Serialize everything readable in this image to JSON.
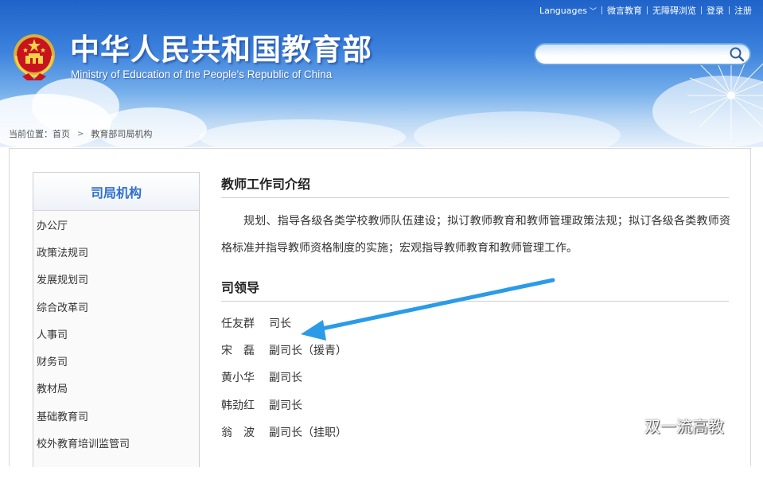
{
  "header": {
    "title": "中华人民共和国教育部",
    "subtitle": "Ministry of Education of the People's Republic of China",
    "topbar": {
      "languages": "Languages",
      "weiyan": "微言教育",
      "accessible": "无障碍浏览",
      "login": "登录",
      "register": "注册"
    },
    "search": {
      "placeholder": ""
    }
  },
  "breadcrumb": {
    "prefix": "当前位置：",
    "home": "首页",
    "current": "教育部司局机构"
  },
  "sidebar": {
    "title": "司局机构",
    "items": [
      {
        "label": "办公厅"
      },
      {
        "label": "政策法规司"
      },
      {
        "label": "发展规划司"
      },
      {
        "label": "综合改革司"
      },
      {
        "label": "人事司"
      },
      {
        "label": "财务司"
      },
      {
        "label": "教材局"
      },
      {
        "label": "基础教育司"
      },
      {
        "label": "校外教育培训监管司"
      }
    ]
  },
  "content": {
    "intro_title": "教师工作司介绍",
    "intro_text": "规划、指导各级各类学校教师队伍建设；拟订教师教育和教师管理政策法规；拟订各级各类教师资格标准并指导教师资格制度的实施；宏观指导教师教育和教师管理工作。",
    "leaders_title": "司领导",
    "leaders": [
      {
        "name": "任友群",
        "title": "司长"
      },
      {
        "name": "宋　磊",
        "title": "副司长（援青）"
      },
      {
        "name": "黄小华",
        "title": "副司长"
      },
      {
        "name": "韩劲红",
        "title": "副司长"
      },
      {
        "name": "翁　波",
        "title": "副司长（挂职）"
      }
    ]
  },
  "watermark": {
    "text": "双一流高教"
  },
  "colors": {
    "accent": "#2f6fcf",
    "arrow": "#2b9be8",
    "header_top": "#1f63c9"
  }
}
